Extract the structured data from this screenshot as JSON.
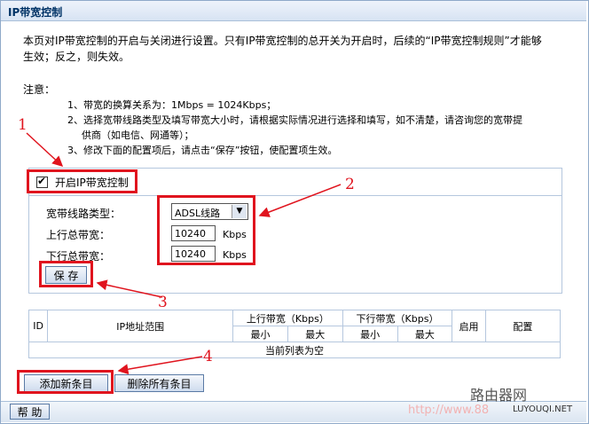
{
  "title": "IP带宽控制",
  "intro": {
    "line1": "本页对IP带宽控制的开启与关闭进行设置。只有IP带宽控制的总开关为开启时，后续的“IP带宽控制规则”才能够",
    "line2": "生效；反之，则失效。"
  },
  "notes": {
    "heading": "注意：",
    "n1": "1、带宽的换算关系为：1Mbps = 1024Kbps；",
    "n2a": "2、选择宽带线路类型及填写带宽大小时，请根据实际情况进行选择和填写，如不清楚，请咨询您的宽带提",
    "n2b": "供商（如电信、网通等）；",
    "n3": "3、修改下面的配置项后，请点击“保存”按钮，使配置项生效。"
  },
  "enable": {
    "label": "开启IP带宽控制",
    "checked": true,
    "mark": "✔"
  },
  "line_type": {
    "label": "宽带线路类型：",
    "value": "ADSL线路"
  },
  "upstream": {
    "label": "上行总带宽：",
    "value": "10240",
    "unit": "Kbps"
  },
  "downstream": {
    "label": "下行总带宽：",
    "value": "10240",
    "unit": "Kbps"
  },
  "save_label": "保 存",
  "table": {
    "h_id": "ID",
    "h_range": "IP地址范围",
    "h_up": "上行带宽（Kbps）",
    "h_down": "下行带宽（Kbps）",
    "h_enable": "启用",
    "h_config": "配置",
    "h_min1": "最小",
    "h_max1": "最大",
    "h_min2": "最小",
    "h_max2": "最大",
    "empty": "当前列表为空"
  },
  "add_label": "添加新条目",
  "delete_all_label": "删除所有条目",
  "help_label": "帮 助",
  "annotations": {
    "a1": "1",
    "a2": "2",
    "a3": "3",
    "a4": "4",
    "color": "#e0141e"
  },
  "watermark": {
    "logo": "路由器网",
    "site": "LUYOUQI.NET",
    "url": "http://www.88"
  }
}
